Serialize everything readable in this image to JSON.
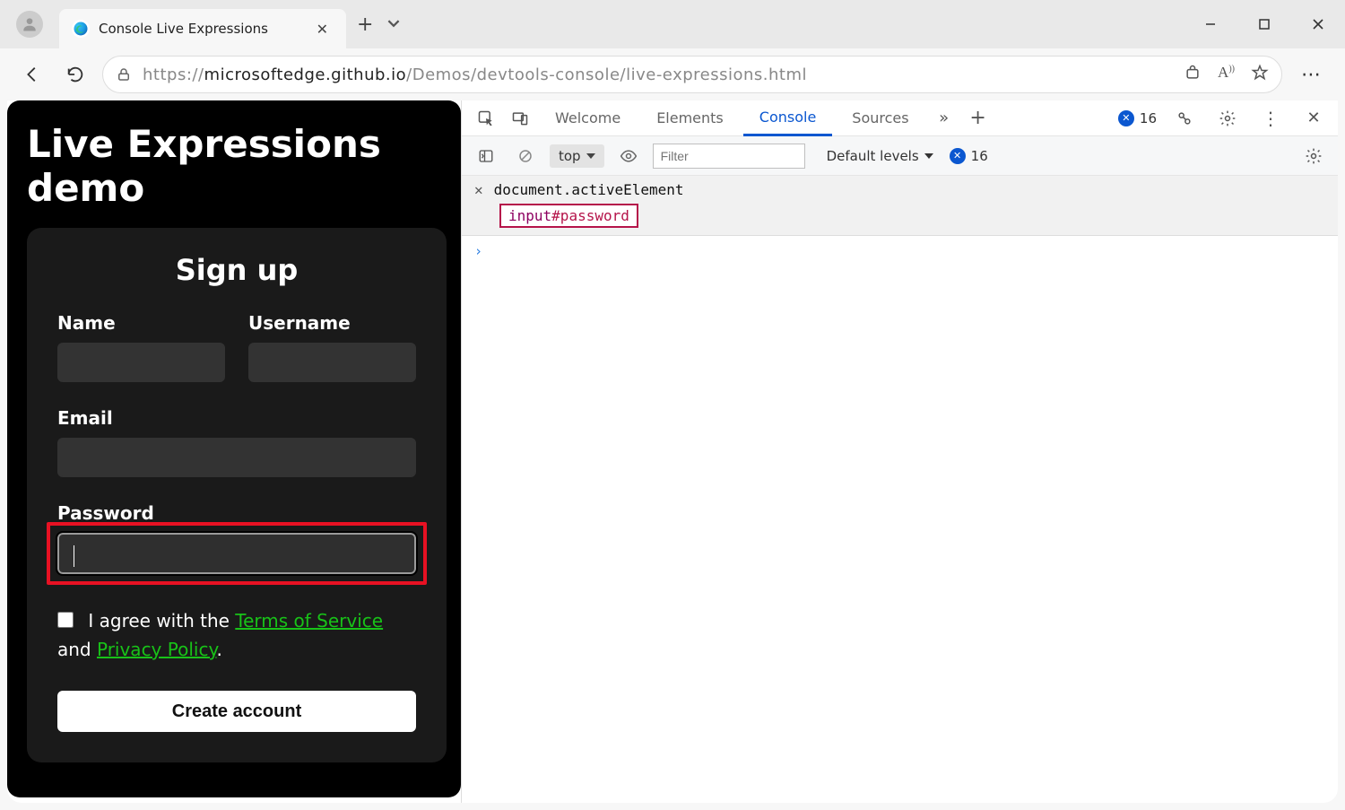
{
  "browser": {
    "tab_title": "Console Live Expressions",
    "url_protocol": "https://",
    "url_host": "microsoftedge.github.io",
    "url_rest": "/Demos/devtools-console/live-expressions.html"
  },
  "page": {
    "title": "Live Expressions demo",
    "card_title": "Sign up",
    "name_label": "Name",
    "username_label": "Username",
    "email_label": "Email",
    "password_label": "Password",
    "agree_prefix": " I agree with the ",
    "tos_link": "Terms of Service",
    "agree_mid": " and ",
    "privacy_link": "Privacy Policy",
    "agree_suffix": ".",
    "submit_label": "Create account"
  },
  "devtools": {
    "tabs": {
      "welcome": "Welcome",
      "elements": "Elements",
      "console": "Console",
      "sources": "Sources"
    },
    "errors_count": "16",
    "context": "top",
    "filter_placeholder": "Filter",
    "levels_label": "Default levels",
    "issues_count": "16",
    "live_expression": "document.activeElement",
    "live_result_tag": "input",
    "live_result_sel": "#password"
  }
}
